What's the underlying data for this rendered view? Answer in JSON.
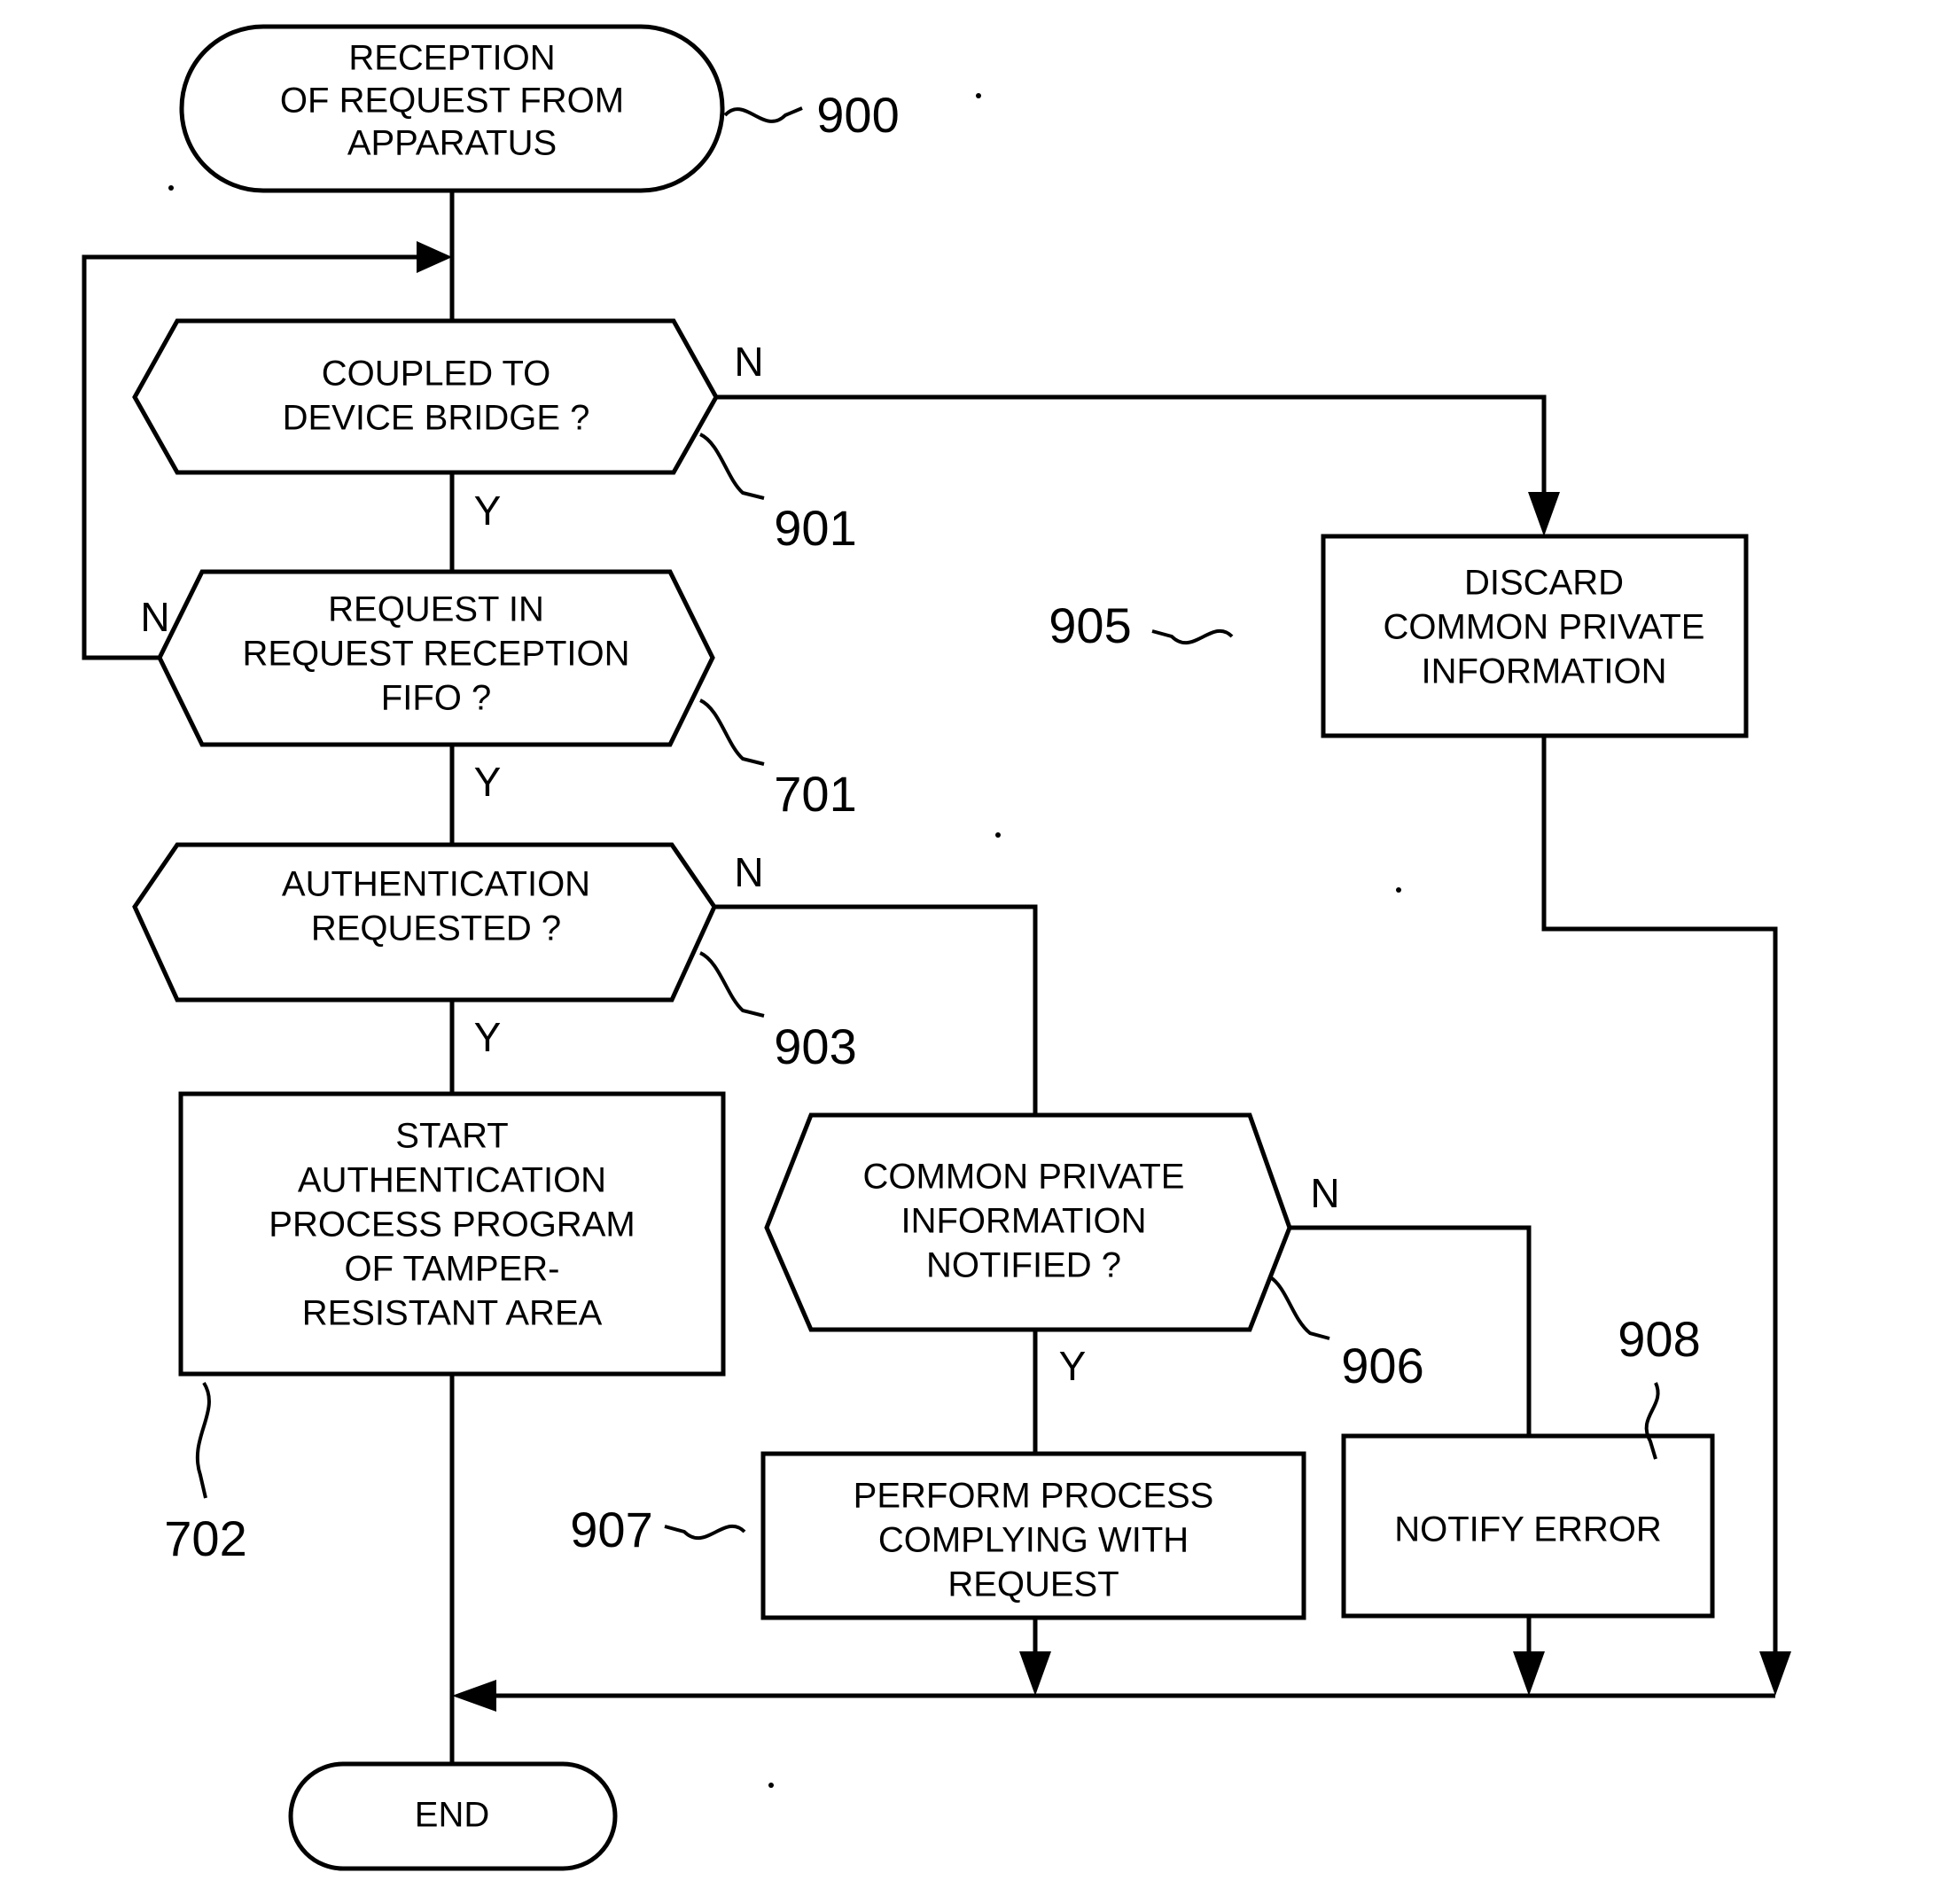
{
  "figure": {
    "type": "flowchart",
    "title": "",
    "background_color": "#ffffff",
    "line_color": "#000000"
  },
  "nodes": [
    {
      "id": "n900",
      "shape": "terminator",
      "ref": "900",
      "lines": [
        "RECEPTION",
        "OF REQUEST FROM",
        "APPARATUS"
      ]
    },
    {
      "id": "n901",
      "shape": "decision",
      "ref": "901",
      "lines": [
        "COUPLED TO",
        "DEVICE BRIDGE ?"
      ],
      "yes_label": "Y",
      "no_label": "N"
    },
    {
      "id": "n701",
      "shape": "decision",
      "ref": "701",
      "lines": [
        "REQUEST IN",
        "REQUEST RECEPTION",
        "FIFO ?"
      ],
      "yes_label": "Y",
      "no_label": "N"
    },
    {
      "id": "n903",
      "shape": "decision",
      "ref": "903",
      "lines": [
        "AUTHENTICATION",
        "REQUESTED ?"
      ],
      "yes_label": "Y",
      "no_label": "N"
    },
    {
      "id": "n702",
      "shape": "process",
      "ref": "702",
      "lines": [
        "START",
        "AUTHENTICATION",
        "PROCESS PROGRAM",
        "OF TAMPER-",
        "RESISTANT AREA"
      ]
    },
    {
      "id": "n905",
      "shape": "process",
      "ref": "905",
      "lines": [
        "DISCARD",
        "COMMON PRIVATE",
        "INFORMATION"
      ]
    },
    {
      "id": "n906",
      "shape": "decision",
      "ref": "906",
      "lines": [
        "COMMON PRIVATE",
        "INFORMATION",
        "NOTIFIED ?"
      ],
      "yes_label": "Y",
      "no_label": "N"
    },
    {
      "id": "n907",
      "shape": "process",
      "ref": "907",
      "lines": [
        "PERFORM PROCESS",
        "COMPLYING WITH",
        "REQUEST"
      ]
    },
    {
      "id": "n908",
      "shape": "process",
      "ref": "908",
      "lines": [
        "NOTIFY ERROR"
      ]
    },
    {
      "id": "nend",
      "shape": "terminator",
      "ref": "",
      "lines": [
        "END"
      ]
    }
  ],
  "text": {
    "n900_l1": "RECEPTION",
    "n900_l2": "OF REQUEST FROM",
    "n900_l3": "APPARATUS",
    "n900_ref": "900",
    "n901_l1": "COUPLED TO",
    "n901_l2": "DEVICE BRIDGE ?",
    "n901_ref": "901",
    "n901_n": "N",
    "n901_y": "Y",
    "n701_l1": "REQUEST IN",
    "n701_l2": "REQUEST RECEPTION",
    "n701_l3": "FIFO ?",
    "n701_ref": "701",
    "n701_n": "N",
    "n701_y": "Y",
    "n903_l1": "AUTHENTICATION",
    "n903_l2": "REQUESTED ?",
    "n903_ref": "903",
    "n903_n": "N",
    "n903_y": "Y",
    "n702_l1": "START",
    "n702_l2": "AUTHENTICATION",
    "n702_l3": "PROCESS PROGRAM",
    "n702_l4": "OF TAMPER-",
    "n702_l5": "RESISTANT AREA",
    "n702_ref": "702",
    "n905_l1": "DISCARD",
    "n905_l2": "COMMON PRIVATE",
    "n905_l3": "INFORMATION",
    "n905_ref": "905",
    "n906_l1": "COMMON PRIVATE",
    "n906_l2": "INFORMATION",
    "n906_l3": "NOTIFIED ?",
    "n906_ref": "906",
    "n906_n": "N",
    "n906_y": "Y",
    "n907_l1": "PERFORM PROCESS",
    "n907_l2": "COMPLYING WITH",
    "n907_l3": "REQUEST",
    "n907_ref": "907",
    "n908_l1": "NOTIFY ERROR",
    "n908_ref": "908",
    "nend_l1": "END"
  },
  "edges": [
    {
      "from": "n900",
      "to": "n901",
      "label": ""
    },
    {
      "from": "n901",
      "to": "n701",
      "label": "Y"
    },
    {
      "from": "n901",
      "to": "n905",
      "label": "N"
    },
    {
      "from": "n701",
      "to": "n903",
      "label": "Y"
    },
    {
      "from": "n701",
      "to": "n901",
      "label": "N"
    },
    {
      "from": "n903",
      "to": "n702",
      "label": "Y"
    },
    {
      "from": "n903",
      "to": "n906",
      "label": "N"
    },
    {
      "from": "n906",
      "to": "n907",
      "label": "Y"
    },
    {
      "from": "n906",
      "to": "n908",
      "label": "N"
    },
    {
      "from": "n702",
      "to": "nend",
      "label": ""
    },
    {
      "from": "n907",
      "to": "nend",
      "label": ""
    },
    {
      "from": "n908",
      "to": "nend",
      "label": ""
    },
    {
      "from": "n905",
      "to": "nend",
      "label": ""
    }
  ]
}
